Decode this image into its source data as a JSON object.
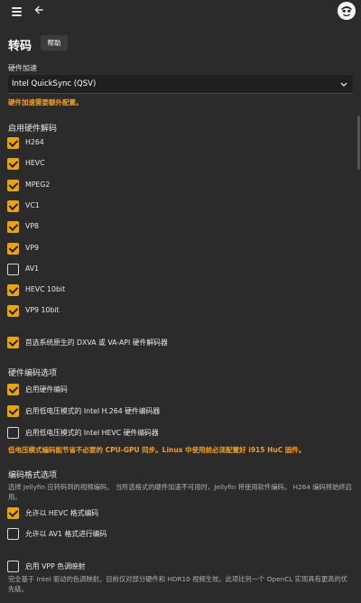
{
  "header": {
    "title": "转码",
    "help_label": "帮助"
  },
  "hw_accel": {
    "label": "硬件加速",
    "selected": "Intel QuickSync (QSV)",
    "warning": "硬件加速需要额外配置。"
  },
  "decoding": {
    "section_title": "启用硬件解码",
    "items": [
      {
        "label": "H264",
        "checked": true
      },
      {
        "label": "HEVC",
        "checked": true
      },
      {
        "label": "MPEG2",
        "checked": true
      },
      {
        "label": "VC1",
        "checked": true
      },
      {
        "label": "VP8",
        "checked": true
      },
      {
        "label": "VP9",
        "checked": true
      },
      {
        "label": "AV1",
        "checked": false
      },
      {
        "label": "HEVC 10bit",
        "checked": true
      },
      {
        "label": "VP9 10bit",
        "checked": true
      }
    ],
    "prefer_native": {
      "label": "首选系统原生的 DXVA 或 VA-API 硬件解码器",
      "checked": true
    }
  },
  "encoding": {
    "section_title": "硬件编码选项",
    "items": [
      {
        "label": "启用硬件编码",
        "checked": true
      },
      {
        "label": "启用低电压模式的 Intel H.264 硬件编码器",
        "checked": true
      },
      {
        "label": "启用低电压模式的 Intel HEVC 硬件编码器",
        "checked": false
      }
    ],
    "warning": "低电压模式编码能节省不必要的 CPU-GPU 同步。Linux 中使用前必须配置好 i915 HuC 固件。"
  },
  "formats": {
    "section_title": "编码格式选项",
    "description": "选择 Jellyfin 应转码到的视频编码。 当所选格式的硬件加速不可用时，Jellyfin 将使用软件编码。 H264 编码将始终启用。",
    "items": [
      {
        "label": "允许以 HEVC 格式编码",
        "checked": true
      },
      {
        "label": "允许以 AV1 格式进行编码",
        "checked": false
      }
    ]
  },
  "vpp": {
    "label": "启用 VPP 色调映射",
    "checked": false,
    "description": "完全基于 Intel 驱动的色调映射。目前仅对部分硬件和 HDR10 视频生效。此项比另一个 OpenCL 实现具有更高的优先级。"
  }
}
